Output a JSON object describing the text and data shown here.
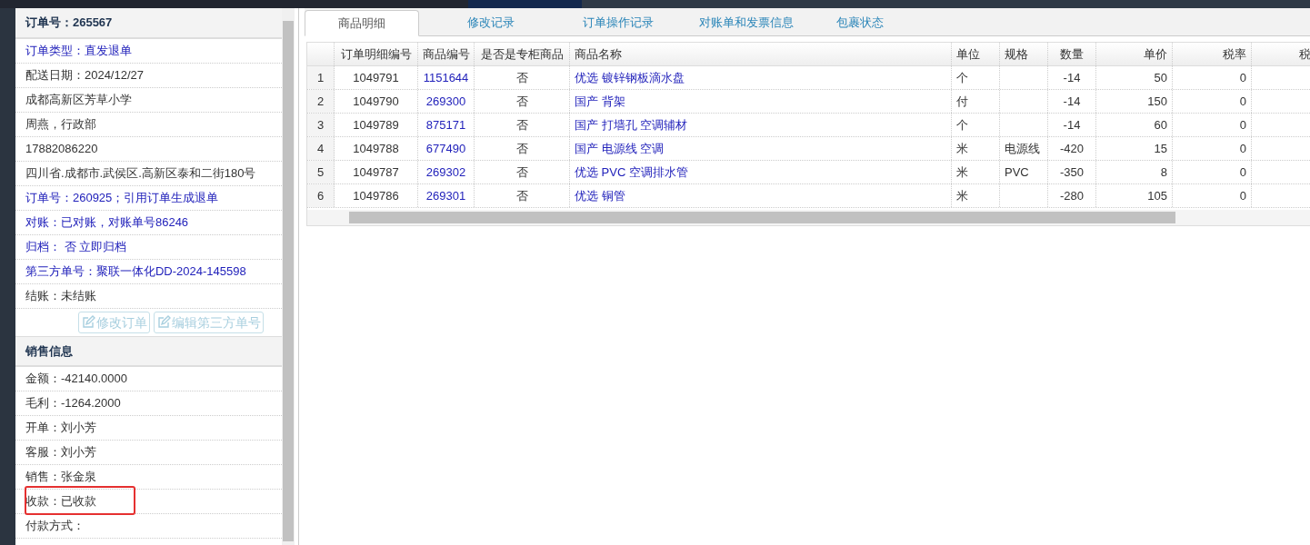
{
  "order_panel": {
    "title": "订单号：265567",
    "rows": [
      {
        "text": "订单类型：直发退单",
        "kind": "link"
      },
      {
        "text": "配送日期：2024/12/27",
        "kind": "text"
      },
      {
        "text": "成都高新区芳草小学",
        "kind": "text"
      },
      {
        "text": "周燕，行政部",
        "kind": "text"
      },
      {
        "text": "17882086220",
        "kind": "text"
      },
      {
        "text": "四川省.成都市.武侯区.高新区泰和二街180号",
        "kind": "text"
      },
      {
        "text": "订单号：260925；引用订单生成退单",
        "kind": "link"
      },
      {
        "text": "对账：已对账，对账单号86246",
        "kind": "link"
      },
      {
        "text": "归档： 否 立即归档",
        "kind": "link"
      },
      {
        "text": "第三方单号：聚联一体化DD-2024-145598",
        "kind": "link"
      },
      {
        "text": "结账：未结账",
        "kind": "text"
      }
    ],
    "buttons": [
      {
        "label": "修改订单",
        "disabled": true
      },
      {
        "label": "编辑第三方单号",
        "disabled": true
      }
    ]
  },
  "sales_panel": {
    "title": "销售信息",
    "rows": [
      {
        "text": "金额：-42140.0000",
        "highlighted": false
      },
      {
        "text": "毛利：-1264.2000",
        "highlighted": false
      },
      {
        "text": "开单：刘小芳",
        "highlighted": false
      },
      {
        "text": "客服：刘小芳",
        "highlighted": false
      },
      {
        "text": "销售：张金泉",
        "highlighted": false
      },
      {
        "text": "收款：已收款",
        "highlighted": true
      },
      {
        "text": "付款方式：",
        "highlighted": false
      }
    ]
  },
  "tabs": [
    {
      "label": "商品明细",
      "selected": true
    },
    {
      "label": "修改记录",
      "selected": false
    },
    {
      "label": "订单操作记录",
      "selected": false
    },
    {
      "label": "对账单和发票信息",
      "selected": false
    },
    {
      "label": "包裹状态",
      "selected": false
    }
  ],
  "table": {
    "columns": [
      "订单明细编号",
      "商品编号",
      "是否是专柜商品",
      "商品名称",
      "单位",
      "规格",
      "数量",
      "单价",
      "税率",
      "税"
    ],
    "rows": [
      {
        "index": "1",
        "cells": [
          "1049791",
          "1151644",
          "否",
          "优选 镀锌钢板滴水盘",
          "个",
          "",
          "-14",
          "50",
          "0"
        ]
      },
      {
        "index": "2",
        "cells": [
          "1049790",
          "269300",
          "否",
          "国产 背架",
          "付",
          "",
          "-14",
          "150",
          "0"
        ]
      },
      {
        "index": "3",
        "cells": [
          "1049789",
          "875171",
          "否",
          "国产 打墙孔 空调辅材",
          "个",
          "",
          "-14",
          "60",
          "0"
        ]
      },
      {
        "index": "4",
        "cells": [
          "1049788",
          "677490",
          "否",
          "国产 电源线 空调",
          "米",
          "电源线",
          "-420",
          "15",
          "0"
        ]
      },
      {
        "index": "5",
        "cells": [
          "1049787",
          "269302",
          "否",
          "优选 PVC 空调排水管",
          "米",
          "PVC",
          "-350",
          "8",
          "0"
        ]
      },
      {
        "index": "6",
        "cells": [
          "1049786",
          "269301",
          "否",
          "优选 铜管",
          "米",
          "",
          "-280",
          "105",
          "0"
        ]
      }
    ]
  }
}
